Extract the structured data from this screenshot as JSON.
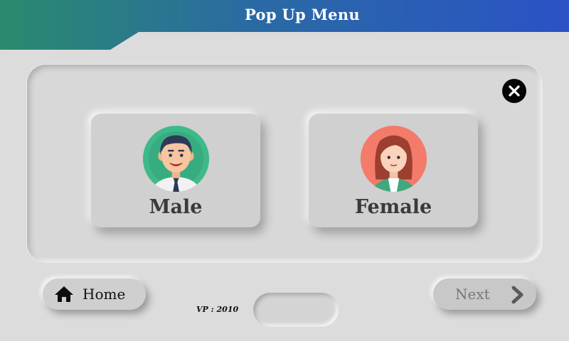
{
  "header": {
    "title": "Pop Up Menu"
  },
  "options": [
    {
      "label": "Male",
      "avatar": "male-avatar-icon"
    },
    {
      "label": "Female",
      "avatar": "female-avatar-icon"
    }
  ],
  "footer": {
    "home_label": "Home",
    "version": "VP : 2010",
    "next_label": "Next"
  },
  "colors": {
    "header_gradient_start": "#2a8a6e",
    "header_gradient_end": "#2b57c8",
    "background": "#dcdcdc",
    "label_text": "#3a3a3a",
    "next_text": "#777777"
  },
  "icons": {
    "close": "close-icon",
    "home": "home-icon",
    "next": "chevron-right-icon"
  }
}
